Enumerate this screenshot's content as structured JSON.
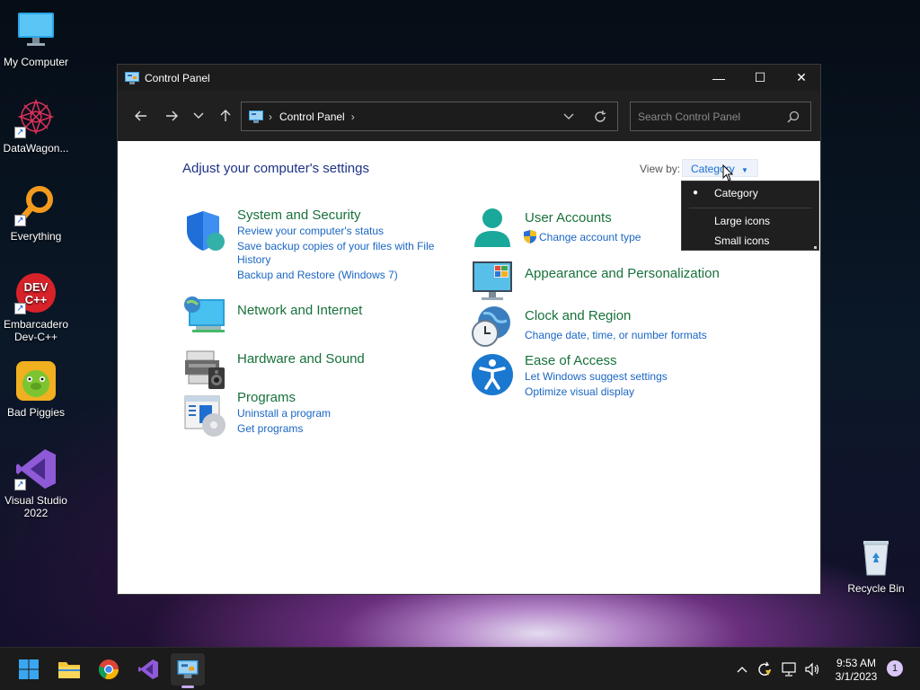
{
  "desktop": {
    "icons": [
      {
        "label": "My Computer"
      },
      {
        "label": "DataWagon..."
      },
      {
        "label": "Everything"
      },
      {
        "label": "Embarcadero\nDev-C++"
      },
      {
        "label": "Bad Piggies"
      },
      {
        "label": "Visual Studio\n2022"
      },
      {
        "label": "Recycle Bin"
      }
    ]
  },
  "window": {
    "title": "Control Panel",
    "controls": {
      "minimize": "—",
      "maximize": "☐",
      "close": "✕"
    },
    "address": {
      "crumb": "Control Panel"
    },
    "search_placeholder": "Search Control Panel",
    "heading": "Adjust your computer's settings",
    "view_by_label": "View by:",
    "view_by_value": "Category",
    "view_options": [
      "Category",
      "Large icons",
      "Small icons"
    ],
    "categories": {
      "system": {
        "title": "System and Security",
        "links": [
          "Review your computer's status",
          "Save backup copies of your files with File",
          "History",
          "Backup and Restore (Windows 7)"
        ]
      },
      "network": {
        "title": "Network and Internet"
      },
      "hardware": {
        "title": "Hardware and Sound"
      },
      "programs": {
        "title": "Programs",
        "links": [
          "Uninstall a program",
          "Get programs"
        ]
      },
      "user": {
        "title": "User Accounts",
        "links": [
          "Change account type"
        ]
      },
      "appearance": {
        "title": "Appearance and Personalization"
      },
      "clock": {
        "title": "Clock and Region",
        "links": [
          "Change date, time, or number formats"
        ]
      },
      "ease": {
        "title": "Ease of Access",
        "links": [
          "Let Windows suggest settings",
          "Optimize visual display"
        ]
      }
    }
  },
  "taskbar": {
    "time": "9:53 AM",
    "date": "3/1/2023",
    "notifications": "1"
  },
  "colors": {
    "link": "#1a66c4",
    "category_title": "#18713b",
    "heading": "#1e3287"
  }
}
